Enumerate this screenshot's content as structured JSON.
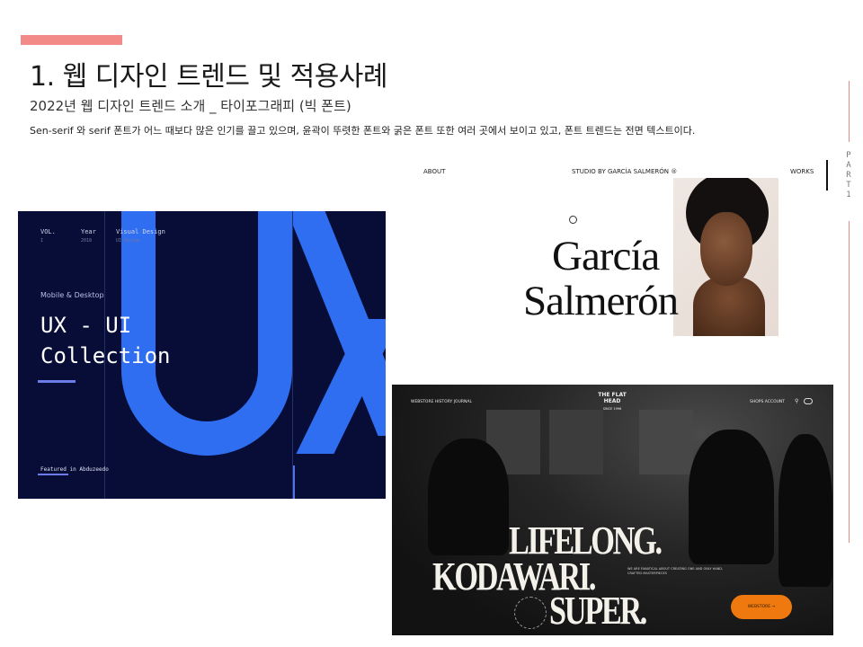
{
  "slide": {
    "title": "1. 웹 디자인 트렌드 및 적용사례",
    "subtitle": "2022년 웹 디자인 트렌드 소개 _ 타이포그래피 (빅 폰트)",
    "description": "Sen-serif 와 serif 폰트가 어느 때보다 많은 인기를 끌고 있으며, 윤곽이 뚜렷한 폰트와 굵은 폰트 또한 여러 곳에서 보이고 있고, 폰트 트렌드는 전면 텍스트이다.",
    "part_label": [
      "P",
      "A",
      "R",
      "T",
      "1"
    ],
    "accent_color": "#f28b87"
  },
  "panel_ux": {
    "meta": [
      {
        "label": "VOL.",
        "value": "I"
      },
      {
        "label": "Year",
        "value": "2018"
      },
      {
        "label": "Visual Design",
        "value": "UI Design"
      }
    ],
    "kicker": "Mobile & Desktop",
    "headline": "UX - UI\nCollection",
    "featured": "Featured in Abduzeedo",
    "background_color": "#070d36",
    "accent_color": "#2f6ef0"
  },
  "panel_garcia": {
    "nav_left": "ABOUT",
    "nav_center": "STUDIO BY GARCÍA SALMERÓN ®",
    "nav_right": "WORKS",
    "name_line1": "García",
    "name_line2": "Salmerón"
  },
  "panel_flathead": {
    "nav_left": "WEBSTORE     HISTORY     JOURNAL",
    "logo": "THE FLAT HEAD",
    "logo_sub": "SINCE 1996",
    "nav_right": "SHOPS     ACCOUNT",
    "headline1": "LIFELONG.",
    "headline2": "KODAWARI.",
    "headline3": "SUPER.",
    "small_text": "WE ARE FANATICAL ABOUT CREATING ONE AND ONLY HAND-CRAFTED MASTERPIECES",
    "button_label": "WEBSTORE →",
    "button_color": "#f0790f"
  }
}
